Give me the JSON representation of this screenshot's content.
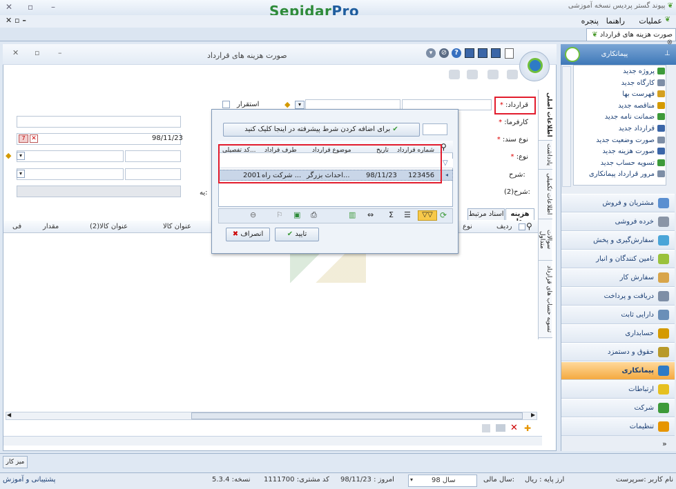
{
  "app": {
    "title": "پیوند گستر پردیس نسخه آموزشی",
    "brand_main": "Sepidar",
    "brand_pro": "Pro",
    "menu": [
      "عملیات",
      "راهنما",
      "پنجره"
    ],
    "doc_tab": "صورت هزینه های قرارداد"
  },
  "window": {
    "title": "صورت هزینه های قرارداد"
  },
  "form": {
    "contract_label": "قرارداد:",
    "employer_label": "کارفرما:",
    "doc_type_label": "نوع سند:",
    "type_label": "نوع:",
    "desc_label": "شرح:",
    "desc2_label": "شرح(2):",
    "stable_label": "استقرار",
    "date_value": "98/11/23",
    "cut_label": "یه:"
  },
  "vtabs": [
    "اطلاعات اصلی",
    "یادداشت",
    "اطلاعات تکمیلی",
    "سوالات متداول",
    "تسویه حساب های قرارداد"
  ],
  "grid": {
    "tabs": [
      "هزینه ها",
      "اسناد مرتبط"
    ],
    "columns": [
      "ردیف",
      "نوع",
      "عنوان کالا",
      "عنوان کالا(2)",
      "مقدار",
      "فی"
    ]
  },
  "popup": {
    "advanced_hint": "برای اضافه کردن شرط پیشرفته در اینجا کلیک کنید",
    "columns": [
      "شماره قرارداد",
      "تاریخ",
      "موضوع قرارداد",
      "طرف قراداد",
      "کد تفصیلی..."
    ],
    "row": {
      "number": "123456",
      "date": "98/11/23",
      "subject": "احداث بزرگر...",
      "party": "شرکت راه ...",
      "code": "2001"
    },
    "ok": "تایید",
    "cancel": "انصراف"
  },
  "sidebar": {
    "title": "پیمانکاری",
    "tree": [
      "پروژه جدید",
      "کارگاه جدید",
      "فهرست بها",
      "مناقصه جدید",
      "ضمانت نامه جدید",
      "قرارداد جدید",
      "صورت وضعیت جدید",
      "صورت هزینه جدید",
      "تسویه حساب جدید",
      "مرور قرارداد پیمانکاری"
    ],
    "buttons": [
      "مشتریان و فروش",
      "خرده فروشی",
      "سفارش‌گیری و پخش",
      "تامین کنندگان و انبار",
      "سفارش کار",
      "دریافت و پرداخت",
      "دارایی ثابت",
      "حسابداری",
      "حقوق و دستمزد",
      "پیمانکاری",
      "ارتباطات",
      "شرکت",
      "تنظیمات"
    ],
    "active": "پیمانکاری"
  },
  "taskbar": {
    "desk": "میز کار"
  },
  "status": {
    "user": "نام کاربر :سرپرست",
    "currency": "ارز پایه : ریال",
    "fiscal_label": "سال مالی:",
    "fiscal_value": "سال 98",
    "today": "امروز : 98/11/23",
    "customer": "کد مشتری: 1111700",
    "version": "نسخه: 5.3.4",
    "support": "پشتیبانی و آموزش"
  },
  "colors": {
    "highlight_red": "#e21b2c",
    "active_orange": "#f4a940",
    "brand_green": "#2e8b3a",
    "brand_blue": "#1f5d9e"
  }
}
